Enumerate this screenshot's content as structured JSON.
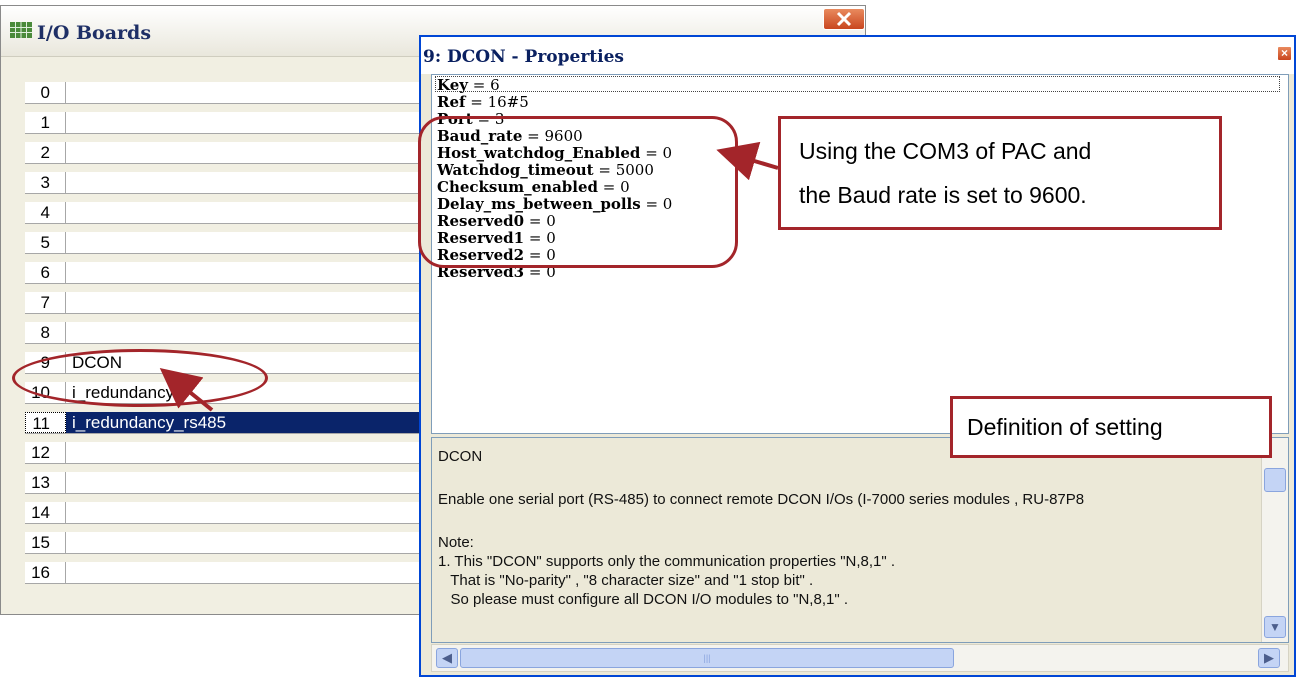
{
  "io_window": {
    "title": "I/O Boards",
    "rows": [
      {
        "num": "0",
        "name": ""
      },
      {
        "num": "1",
        "name": ""
      },
      {
        "num": "2",
        "name": ""
      },
      {
        "num": "3",
        "name": ""
      },
      {
        "num": "4",
        "name": ""
      },
      {
        "num": "5",
        "name": ""
      },
      {
        "num": "6",
        "name": ""
      },
      {
        "num": "7",
        "name": ""
      },
      {
        "num": "8",
        "name": ""
      },
      {
        "num": "9",
        "name": "DCON"
      },
      {
        "num": "10",
        "name": "i_redundancy"
      },
      {
        "num": "11",
        "name": "i_redundancy_rs485"
      },
      {
        "num": "12",
        "name": ""
      },
      {
        "num": "13",
        "name": ""
      },
      {
        "num": "14",
        "name": ""
      },
      {
        "num": "15",
        "name": ""
      },
      {
        "num": "16",
        "name": ""
      }
    ],
    "selected_row": "11"
  },
  "prop_window": {
    "title": "9: DCON - Properties",
    "close_glyph": "×",
    "properties": [
      {
        "key": "Key",
        "value": " = 6"
      },
      {
        "key": "Ref",
        "value": " = 16#5"
      },
      {
        "key": "Port",
        "value": " = 3"
      },
      {
        "key": "Baud_rate",
        "value": " = 9600"
      },
      {
        "key": "Host_watchdog_Enabled",
        "value": " = 0"
      },
      {
        "key": "Watchdog_timeout",
        "value": " = 5000"
      },
      {
        "key": "Checksum_enabled",
        "value": " = 0"
      },
      {
        "key": "Delay_ms_between_polls",
        "value": " = 0"
      },
      {
        "key": "Reserved0",
        "value": " = 0"
      },
      {
        "key": "Reserved1",
        "value": " = 0"
      },
      {
        "key": "Reserved2",
        "value": " = 0"
      },
      {
        "key": "Reserved3",
        "value": " = 0"
      }
    ],
    "description": [
      "DCON",
      "",
      "Enable one serial port (RS-485) to connect remote DCON I/Os (I-7000 series modules , RU-87P8",
      "",
      "Note:",
      "1. This \"DCON\" supports only the communication properties \"N,8,1\" .",
      "   That is \"No-parity\" , \"8 character size\" and \"1 stop bit\" .",
      "   So please must configure all DCON I/O modules to \"N,8,1\" ."
    ],
    "scroll": {
      "up": "▲",
      "down": "▼",
      "left": "◀",
      "right": "▶",
      "thumb_grip": "|||"
    }
  },
  "annotations": {
    "com3_line1": "Using the COM3 of PAC and",
    "com3_line2": "the Baud rate is set to 9600.",
    "definition": "Definition of setting",
    "color": "#a3252a"
  }
}
